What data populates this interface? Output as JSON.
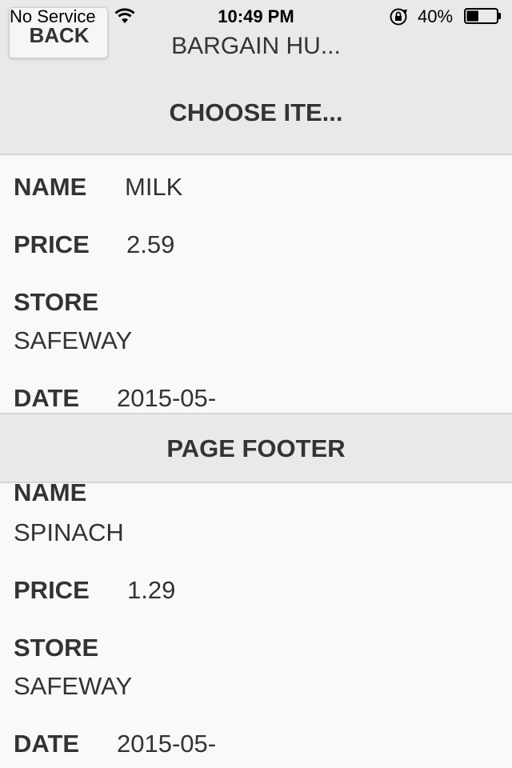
{
  "status_bar": {
    "carrier": "No Service",
    "time": "10:49 PM",
    "battery": "40%",
    "wifi_icon": "wifi-icon",
    "lock_icon": "rotation-lock-icon",
    "battery_icon": "battery-icon",
    "battery_level": 0.4
  },
  "header": {
    "back_label": "BACK",
    "title": "BARGAIN HU..."
  },
  "subheader": {
    "title": "CHOOSE ITE..."
  },
  "items": [
    {
      "name_label": "NAME",
      "name": "MILK",
      "price_label": "PRICE",
      "price": "2.59",
      "store_label": "STORE",
      "store": "SAFEWAY",
      "date_label": "DATE",
      "date": "2015-05-"
    },
    {
      "name_label": "NAME",
      "name": "SPINACH",
      "price_label": "PRICE",
      "price": "1.29",
      "store_label": "STORE",
      "store": "SAFEWAY",
      "date_label": "DATE",
      "date": "2015-05-"
    }
  ],
  "footer": {
    "title": "PAGE FOOTER"
  },
  "colors": {
    "header_bg": "#e9e9e9",
    "content_bg": "#f9f9f9",
    "text": "#333333"
  }
}
